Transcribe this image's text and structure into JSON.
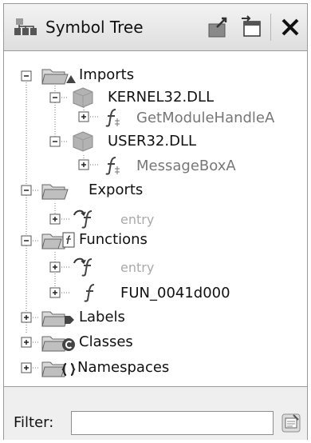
{
  "panel": {
    "title": "Symbol Tree"
  },
  "toolbar": {
    "icons": [
      "navigate-icon",
      "new-window-icon",
      "close-icon"
    ],
    "close_glyph": "✕"
  },
  "tree": {
    "nodes": [
      {
        "label": "Imports",
        "level": 0,
        "expander": "−",
        "icon": "folder-import-icon"
      },
      {
        "label": "KERNEL32.DLL",
        "level": 1,
        "expander": "−",
        "icon": "library-icon"
      },
      {
        "label": "GetModuleHandleA",
        "level": 2,
        "expander": "+",
        "icon": "external-function-icon"
      },
      {
        "label": "USER32.DLL",
        "level": 1,
        "expander": "−",
        "icon": "library-icon"
      },
      {
        "label": "MessageBoxA",
        "level": 2,
        "expander": "+",
        "icon": "external-function-icon"
      },
      {
        "label": "Exports",
        "level": 0,
        "expander": "−",
        "icon": "folder-export-icon"
      },
      {
        "label": "entry",
        "level": 1,
        "expander": "+",
        "icon": "entry-function-icon"
      },
      {
        "label": "Functions",
        "level": 0,
        "expander": "−",
        "icon": "folder-function-icon"
      },
      {
        "label": "entry",
        "level": 1,
        "expander": "+",
        "icon": "entry-function-icon"
      },
      {
        "label": "FUN_0041d000",
        "level": 1,
        "expander": "+",
        "icon": "function-icon"
      },
      {
        "label": "Labels",
        "level": 0,
        "expander": "+",
        "icon": "folder-label-icon"
      },
      {
        "label": "Classes",
        "level": 0,
        "expander": "+",
        "icon": "folder-class-icon"
      },
      {
        "label": "Namespaces",
        "level": 0,
        "expander": "+",
        "icon": "folder-namespace-icon"
      }
    ]
  },
  "filter": {
    "label": "Filter:",
    "value": "",
    "placeholder": ""
  }
}
